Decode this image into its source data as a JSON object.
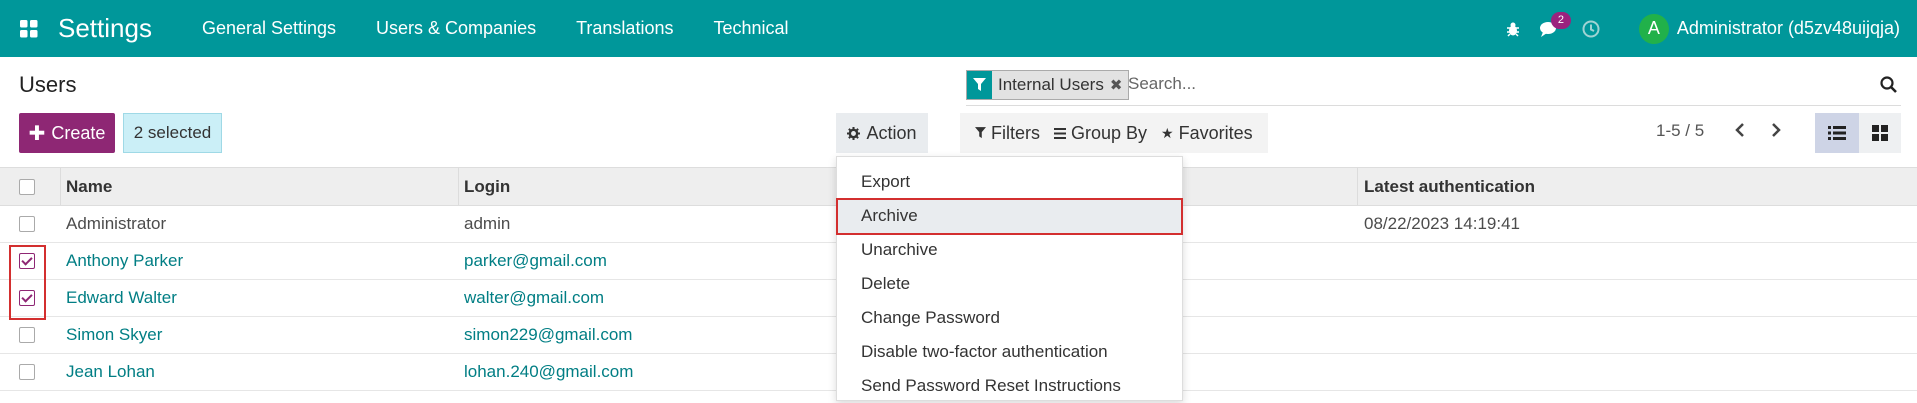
{
  "navbar": {
    "app_title": "Settings",
    "menus": [
      "General Settings",
      "Users & Companies",
      "Translations",
      "Technical"
    ],
    "messages_count": "2",
    "user_initial": "A",
    "user_name": "Administrator (d5zv48uijqja)",
    "color": "#00979a"
  },
  "control_panel": {
    "title": "Users",
    "create_label": "Create",
    "selected_label": "2 selected",
    "action_label": "Action",
    "search": {
      "facet_value": "Internal Users",
      "placeholder": "Search..."
    },
    "filters_label": "Filters",
    "groupby_label": "Group By",
    "favorites_label": "Favorites",
    "pager": "1-5 / 5"
  },
  "table": {
    "headers": [
      "Name",
      "Login",
      "Latest authentication"
    ],
    "rows": [
      {
        "name": "Administrator",
        "login": "admin",
        "latest_auth": "08/22/2023 14:19:41",
        "checked": false,
        "link": false
      },
      {
        "name": "Anthony Parker",
        "login": "parker@gmail.com",
        "latest_auth": "",
        "checked": true,
        "link": true
      },
      {
        "name": "Edward Walter",
        "login": "walter@gmail.com",
        "latest_auth": "",
        "checked": true,
        "link": true
      },
      {
        "name": "Simon Skyer",
        "login": "simon229@gmail.com",
        "latest_auth": "",
        "checked": false,
        "link": true
      },
      {
        "name": "Jean Lohan",
        "login": "lohan.240@gmail.com",
        "latest_auth": "",
        "checked": false,
        "link": true
      }
    ]
  },
  "action_menu": {
    "items": [
      "Export",
      "Archive",
      "Unarchive",
      "Delete",
      "Change Password",
      "Disable two-factor authentication",
      "Send Password Reset Instructions"
    ],
    "active_item": "Archive"
  },
  "colors": {
    "primary": "#8e2774",
    "link": "#017e84",
    "highlight": "#d32f2f"
  }
}
